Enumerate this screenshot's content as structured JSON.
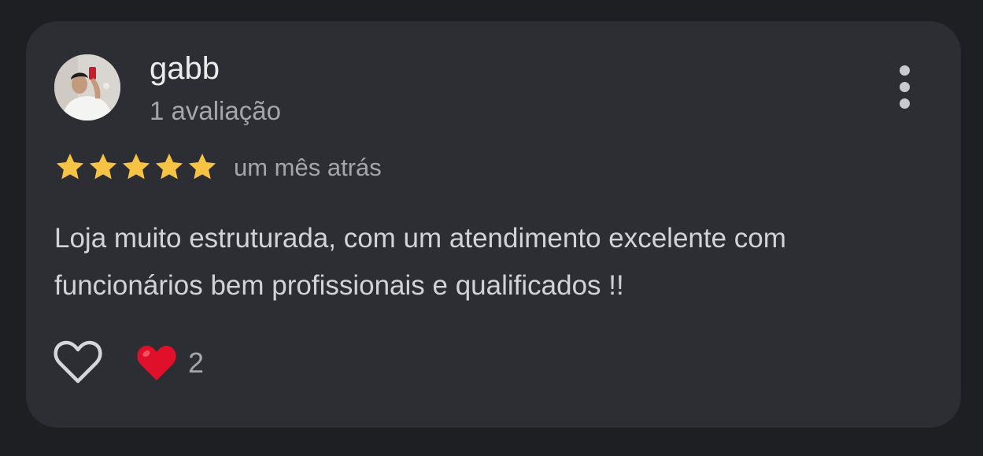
{
  "review": {
    "author": {
      "name": "gabb",
      "review_count": "1 avaliação",
      "avatar": "user-photo"
    },
    "rating": 5,
    "rating_max": 5,
    "time": "um mês atrás",
    "text": "Loja muito estruturada, com um atendimento excelente com funcionários bem profissionais e qualificados !!",
    "reactions": {
      "like_icon": "heart-outline-icon",
      "reaction_icon": "red-heart-icon",
      "count": "2"
    },
    "menu_icon": "more-vertical-icon"
  },
  "colors": {
    "background": "#1e1f23",
    "card": "#2d2e33",
    "star": "#f6c344",
    "heart": "#e0102a",
    "primary_text": "#ececec",
    "secondary_text": "#a5a6ab"
  }
}
